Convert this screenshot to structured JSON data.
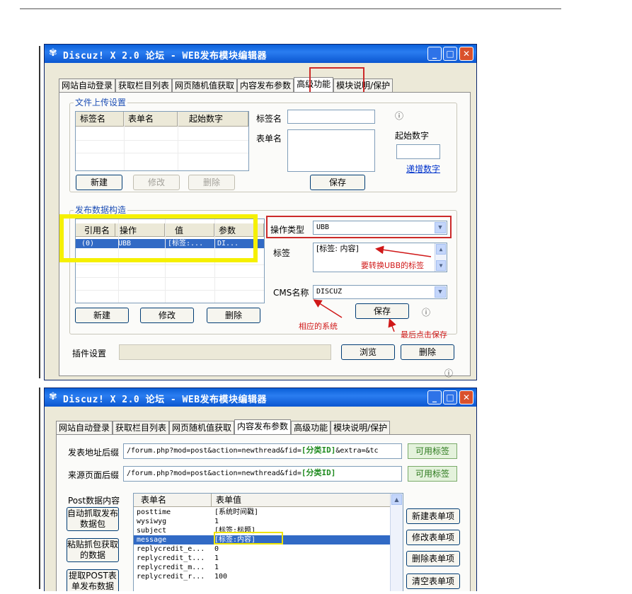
{
  "w1": {
    "title": "Discuz! X 2.0 论坛 - WEB发布模块编辑器",
    "tabs": [
      "网站自动登录",
      "获取栏目列表",
      "网页随机值获取",
      "内容发布参数",
      "高级功能",
      "模块说明/保护"
    ],
    "upload": {
      "legend": "文件上传设置",
      "headers": [
        "标签名",
        "表单名",
        "起始数字"
      ],
      "tag_label": "标签名",
      "form_label": "表单名",
      "start_label": "起始数字",
      "increment_link": "递增数字",
      "new_btn": "新建",
      "edit_btn": "修改",
      "delete_btn": "删除",
      "save_btn": "保存"
    },
    "filter": {
      "legend": "发布数据构造",
      "headers": [
        "引用名",
        "操作",
        "值",
        "参数"
      ],
      "row": [
        "(0)",
        "UBB",
        "[标签:...",
        "DI..."
      ],
      "op_type_label": "操作类型",
      "op_type_value": "UBB",
      "tag_label": "标签",
      "tag_value": "[标签: 内容]",
      "cms_label": "CMS名称",
      "cms_value": "DISCUZ",
      "new_btn": "新建",
      "edit_btn": "修改",
      "delete_btn": "删除",
      "save_btn": "保存"
    },
    "plugin_label": "插件设置",
    "browse_btn": "浏览",
    "plugin_delete_btn": "删除",
    "annotations": {
      "ubb": "要转换UBB的标签",
      "system": "相应的系统",
      "save": "最后点击保存"
    }
  },
  "w2": {
    "title": "Discuz! X 2.0 论坛 - WEB发布模块编辑器",
    "tabs": [
      "网站自动登录",
      "获取栏目列表",
      "网页随机值获取",
      "内容发布参数",
      "高级功能",
      "模块说明/保护"
    ],
    "post_url_label": "发表地址后缀",
    "post_url_prefix": "/forum.php?mod=post&action=newthread&fid=",
    "post_url_tag": "[分类ID]",
    "post_url_suffix": "&extra=&tc",
    "ref_url_label": "来源页面后缀",
    "ref_url_prefix": "/forum.php?mod=post&action=newthread&fid=",
    "ref_url_tag": "[分类ID]",
    "avail_tag_btn": "可用标签",
    "post_data_label": "Post数据内容",
    "headers": [
      "表单名",
      "表单值"
    ],
    "rows": [
      [
        "posttime",
        "[系统时间戳]"
      ],
      [
        "wysiwyg",
        "1"
      ],
      [
        "subject",
        "[标签:标题]"
      ],
      [
        "message",
        "[标签:内容]"
      ],
      [
        "replycredit_e...",
        "0"
      ],
      [
        "replycredit_t...",
        "1"
      ],
      [
        "replycredit_m...",
        "1"
      ],
      [
        "replycredit_r...",
        "100"
      ]
    ],
    "auto_capture_btn": "自动抓取发布数据包",
    "paste_btn": "粘贴抓包获取的数据",
    "extract_btn": "提取POST表单发布数据",
    "new_item_btn": "新建表单项",
    "edit_item_btn": "修改表单项",
    "delete_item_btn": "删除表单项",
    "clear_item_btn": "清空表单项"
  }
}
